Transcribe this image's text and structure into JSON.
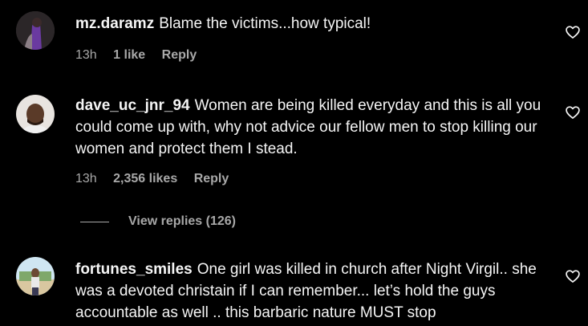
{
  "comments": [
    {
      "username": "mz.daramz",
      "text": "Blame the victims...how typical!",
      "time": "13h",
      "likes": "1 like",
      "reply_label": "Reply",
      "avatar_icon": "profile-photo"
    },
    {
      "username": "dave_uc_jnr_94",
      "text": "Women are being killed everyday and this is all you could come up with, why not advice our fellow men to stop killing our women and protect them I stead.",
      "time": "13h",
      "likes": "2,356 likes",
      "reply_label": "Reply",
      "avatar_icon": "profile-photo",
      "view_replies": "View replies (126)"
    },
    {
      "username": "fortunes_smiles",
      "text": "One girl was killed in church after Night Virgil.. she was a devoted christain if I can remember... let’s hold the guys accountable as well .. this barbaric nature MUST stop",
      "avatar_icon": "profile-photo"
    }
  ],
  "icons": {
    "like": "heart-outline-icon"
  },
  "colors": {
    "background": "#000000",
    "text": "#f5f5f5",
    "secondary": "#a8a8a8"
  }
}
